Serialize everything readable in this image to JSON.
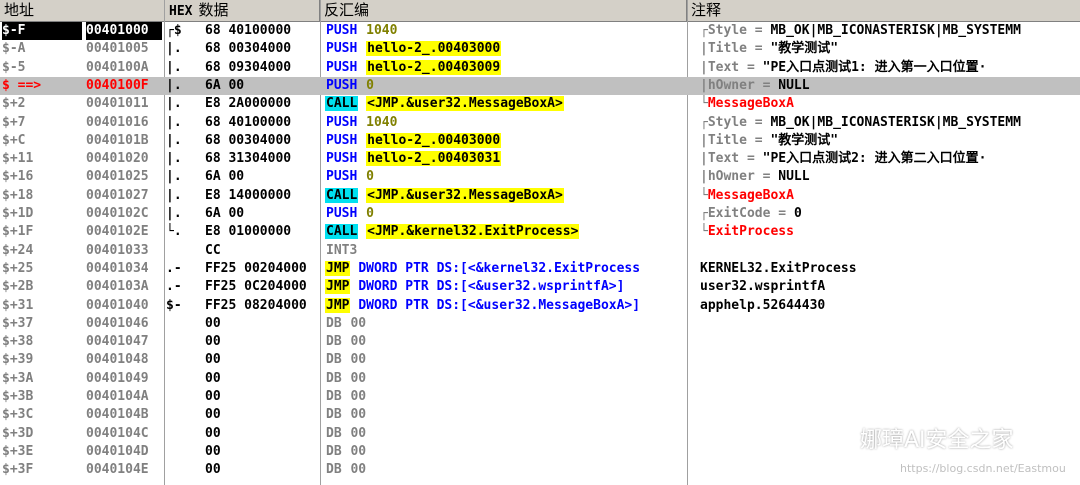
{
  "header": {
    "col_address": "地址",
    "col_hex_tag": "HEX",
    "col_hex": "数据",
    "col_disasm": "反汇编",
    "col_comment": "注释"
  },
  "rows": [
    {
      "off": "$-F",
      "addr": "00401000",
      "br": "┌$",
      "hex": "68 40100000",
      "mn": "PUSH",
      "mnk": "push",
      "op": "1040",
      "opk": "num",
      "cpar": "┌Style",
      "csep": " = ",
      "cval": "MB_OK|MB_ICONASTERISK|MB_SYSTEMM",
      "ck": "param"
    },
    {
      "off": "$-A",
      "addr": "00401005",
      "br": "|.",
      "hex": "68 00304000",
      "mn": "PUSH",
      "mnk": "push",
      "op": "hello-2_.00403000",
      "opk": "hl",
      "cpar": "|Title",
      "csep": " = ",
      "cval": "\"教学测试\"",
      "ck": "param"
    },
    {
      "off": "$-5",
      "addr": "0040100A",
      "br": "|.",
      "hex": "68 09304000",
      "mn": "PUSH",
      "mnk": "push",
      "op": "hello-2_.00403009",
      "opk": "hl",
      "cpar": "|Text",
      "csep": " = ",
      "cval": "\"PE入口点测试1: 进入第一入口位置·",
      "ck": "param"
    },
    {
      "off": "$ ==>",
      "addr": "0040100F",
      "br": "|.",
      "hex": "6A 00",
      "mn": "PUSH",
      "mnk": "push",
      "op": "0",
      "opk": "num",
      "cpar": "|hOwner",
      "csep": " = ",
      "cval": "NULL",
      "ck": "param"
    },
    {
      "off": "$+2",
      "addr": "00401011",
      "br": "|.",
      "hex": "E8 2A000000",
      "mn": "CALL",
      "mnk": "call",
      "op": "<JMP.&user32.MessageBoxA>",
      "opk": "hl",
      "cpar": "└",
      "csep": "",
      "cval": "MessageBoxA",
      "ck": "red"
    },
    {
      "off": "$+7",
      "addr": "00401016",
      "br": "|.",
      "hex": "68 40100000",
      "mn": "PUSH",
      "mnk": "push",
      "op": "1040",
      "opk": "num",
      "cpar": "┌Style",
      "csep": " = ",
      "cval": "MB_OK|MB_ICONASTERISK|MB_SYSTEMM",
      "ck": "param"
    },
    {
      "off": "$+C",
      "addr": "0040101B",
      "br": "|.",
      "hex": "68 00304000",
      "mn": "PUSH",
      "mnk": "push",
      "op": "hello-2_.00403000",
      "opk": "hl",
      "cpar": "|Title",
      "csep": " = ",
      "cval": "\"教学测试\"",
      "ck": "param"
    },
    {
      "off": "$+11",
      "addr": "00401020",
      "br": "|.",
      "hex": "68 31304000",
      "mn": "PUSH",
      "mnk": "push",
      "op": "hello-2_.00403031",
      "opk": "hl",
      "cpar": "|Text",
      "csep": " = ",
      "cval": "\"PE入口点测试2: 进入第二入口位置·",
      "ck": "param"
    },
    {
      "off": "$+16",
      "addr": "00401025",
      "br": "|.",
      "hex": "6A 00",
      "mn": "PUSH",
      "mnk": "push",
      "op": "0",
      "opk": "num",
      "cpar": "|hOwner",
      "csep": " = ",
      "cval": "NULL",
      "ck": "param"
    },
    {
      "off": "$+18",
      "addr": "00401027",
      "br": "|.",
      "hex": "E8 14000000",
      "mn": "CALL",
      "mnk": "call",
      "op": "<JMP.&user32.MessageBoxA>",
      "opk": "hl",
      "cpar": "└",
      "csep": "",
      "cval": "MessageBoxA",
      "ck": "red"
    },
    {
      "off": "$+1D",
      "addr": "0040102C",
      "br": "|.",
      "hex": "6A 00",
      "mn": "PUSH",
      "mnk": "push",
      "op": "0",
      "opk": "num",
      "cpar": "┌ExitCode",
      "csep": " = ",
      "cval": "0",
      "ck": "param"
    },
    {
      "off": "$+1F",
      "addr": "0040102E",
      "br": "└.",
      "hex": "E8 01000000",
      "mn": "CALL",
      "mnk": "call",
      "op": "<JMP.&kernel32.ExitProcess>",
      "opk": "hl",
      "cpar": "└",
      "csep": "",
      "cval": "ExitProcess",
      "ck": "red"
    },
    {
      "off": "$+24",
      "addr": "00401033",
      "br": "",
      "hex": "CC",
      "mn": "INT3",
      "mnk": "int3",
      "op": "",
      "opk": "none",
      "cpar": "",
      "csep": "",
      "cval": "",
      "ck": "plain"
    },
    {
      "off": "$+25",
      "addr": "00401034",
      "br": ".-",
      "hex": "FF25 00204000",
      "mn": "JMP",
      "mnk": "jmp",
      "op": "DWORD PTR DS:[<&kernel32.ExitProcess",
      "opk": "blue",
      "cpar": "",
      "csep": "",
      "cval": "KERNEL32.ExitProcess",
      "ck": "plain"
    },
    {
      "off": "$+2B",
      "addr": "0040103A",
      "br": ".-",
      "hex": "FF25 0C204000",
      "mn": "JMP",
      "mnk": "jmp",
      "op": "DWORD PTR DS:[<&user32.wsprintfA>]",
      "opk": "blue",
      "cpar": "",
      "csep": "",
      "cval": "user32.wsprintfA",
      "ck": "plain"
    },
    {
      "off": "$+31",
      "addr": "00401040",
      "br": "$-",
      "hex": "FF25 08204000",
      "mn": "JMP",
      "mnk": "jmp",
      "op": "DWORD PTR DS:[<&user32.MessageBoxA>]",
      "opk": "blue",
      "cpar": "",
      "csep": "",
      "cval": "apphelp.52644430",
      "ck": "plain"
    },
    {
      "off": "$+37",
      "addr": "00401046",
      "br": "",
      "hex": "00",
      "mn": "DB",
      "mnk": "db",
      "op": "00",
      "opk": "db",
      "cpar": "",
      "csep": "",
      "cval": "",
      "ck": "plain"
    },
    {
      "off": "$+38",
      "addr": "00401047",
      "br": "",
      "hex": "00",
      "mn": "DB",
      "mnk": "db",
      "op": "00",
      "opk": "db",
      "cpar": "",
      "csep": "",
      "cval": "",
      "ck": "plain"
    },
    {
      "off": "$+39",
      "addr": "00401048",
      "br": "",
      "hex": "00",
      "mn": "DB",
      "mnk": "db",
      "op": "00",
      "opk": "db",
      "cpar": "",
      "csep": "",
      "cval": "",
      "ck": "plain"
    },
    {
      "off": "$+3A",
      "addr": "00401049",
      "br": "",
      "hex": "00",
      "mn": "DB",
      "mnk": "db",
      "op": "00",
      "opk": "db",
      "cpar": "",
      "csep": "",
      "cval": "",
      "ck": "plain"
    },
    {
      "off": "$+3B",
      "addr": "0040104A",
      "br": "",
      "hex": "00",
      "mn": "DB",
      "mnk": "db",
      "op": "00",
      "opk": "db",
      "cpar": "",
      "csep": "",
      "cval": "",
      "ck": "plain"
    },
    {
      "off": "$+3C",
      "addr": "0040104B",
      "br": "",
      "hex": "00",
      "mn": "DB",
      "mnk": "db",
      "op": "00",
      "opk": "db",
      "cpar": "",
      "csep": "",
      "cval": "",
      "ck": "plain"
    },
    {
      "off": "$+3D",
      "addr": "0040104C",
      "br": "",
      "hex": "00",
      "mn": "DB",
      "mnk": "db",
      "op": "00",
      "opk": "db",
      "cpar": "",
      "csep": "",
      "cval": "",
      "ck": "plain"
    },
    {
      "off": "$+3E",
      "addr": "0040104D",
      "br": "",
      "hex": "00",
      "mn": "DB",
      "mnk": "db",
      "op": "00",
      "opk": "db",
      "cpar": "",
      "csep": "",
      "cval": "",
      "ck": "plain"
    },
    {
      "off": "$+3F",
      "addr": "0040104E",
      "br": "",
      "hex": "00",
      "mn": "DB",
      "mnk": "db",
      "op": "00",
      "opk": "db",
      "cpar": "",
      "csep": "",
      "cval": "",
      "ck": "plain"
    }
  ],
  "watermark": {
    "text": "娜璋AI安全之家",
    "icon": "wechat-icon",
    "source": "https://blog.csdn.net/Eastmou"
  },
  "colors": {
    "current_row": "#c0c0c0",
    "call_highlight": "#00e0f0",
    "jmp_highlight": "#ffff00",
    "push_text": "#0000ff",
    "api_name": "#ff0000"
  }
}
